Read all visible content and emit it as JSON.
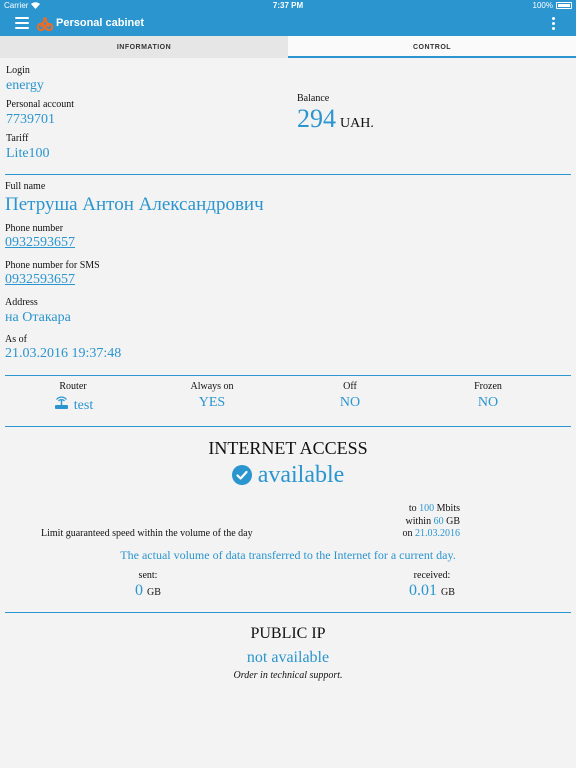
{
  "status": {
    "carrier": "Carrier",
    "time": "7:37 PM",
    "battery": "100%"
  },
  "navbar": {
    "title": "Personal cabinet"
  },
  "tabs": [
    {
      "label": "INFORMATION"
    },
    {
      "label": "CONTROL"
    }
  ],
  "account": {
    "login_label": "Login",
    "login": "energy",
    "account_label": "Personal account",
    "account": "7739701",
    "tariff_label": "Tariff",
    "tariff": "Lite100",
    "balance_label": "Balance",
    "balance": "294",
    "balance_unit": "UAH."
  },
  "person": {
    "fullname_label": "Full name",
    "fullname": "Петруша Антон Александрович",
    "phone_label": "Phone number",
    "phone": "0932593657",
    "sms_label": "Phone number for SMS",
    "sms": "0932593657",
    "address_label": "Address",
    "address": "на Отакара",
    "asof_label": "As of",
    "asof": "21.03.2016 19:37:48"
  },
  "device": {
    "router_label": "Router",
    "router": "test",
    "always_label": "Always on",
    "always": "YES",
    "off_label": "Off",
    "off": "NO",
    "frozen_label": "Frozen",
    "frozen": "NO"
  },
  "internet": {
    "title": "INTERNET ACCESS",
    "status": "available",
    "to_prefix": "to",
    "speed": "100",
    "speed_unit": "Mbits",
    "within_prefix": "within",
    "volume": "60",
    "volume_unit": "GB",
    "on_prefix": "on",
    "date": "21.03.2016",
    "limit_text": "Limit guaranteed speed within the volume of the day",
    "transfer_text": "The actual volume of data transferred to the Internet for a current day.",
    "sent_label": "sent:",
    "sent": "0",
    "sent_unit": "GB",
    "received_label": "received:",
    "received": "0.01",
    "received_unit": "GB"
  },
  "public_ip": {
    "title": "PUBLIC IP",
    "status": "not available",
    "note": "Order in technical support."
  }
}
